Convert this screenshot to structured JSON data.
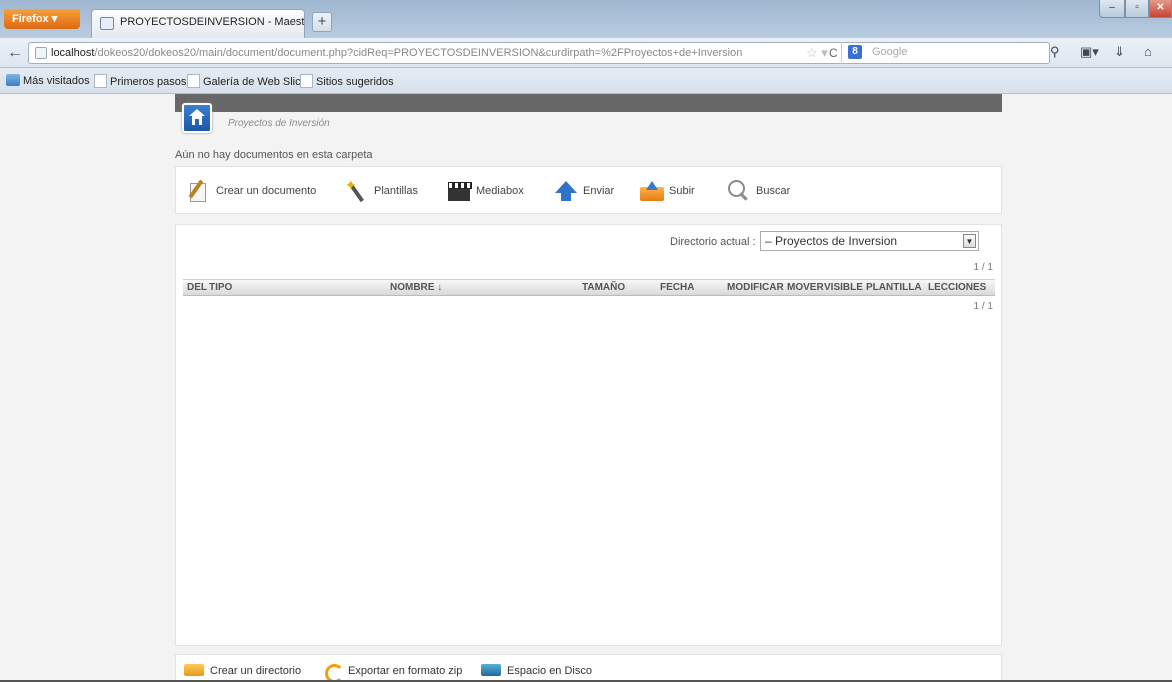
{
  "browser": {
    "app_button": "Firefox",
    "tab_title": "PROYECTOSDEINVERSION - Maestria en ...",
    "new_tab": "+",
    "url_host": "localhost",
    "url_rest": "/dokeos20/dokeos20/main/document/document.php?cidReq=PROYECTOSDEINVERSION&curdirpath=%2FProyectos+de+Inversion",
    "search_engine": "Google",
    "bookmarks": [
      "Más visitados",
      "Primeros pasos",
      "Galería de Web Slice",
      "Sitios sugeridos"
    ]
  },
  "page": {
    "breadcrumb": "Proyectos de Inversión",
    "empty_message": "Aún no hay documentos en esta carpeta",
    "toolbar": {
      "create_document": "Crear un documento",
      "templates": "Plantillas",
      "mediabox": "Mediabox",
      "send": "Enviar",
      "upload": "Subir",
      "search": "Buscar"
    },
    "current_dir_label": "Directorio actual :",
    "current_dir_value": "– Proyectos de Inversion",
    "pager_top": "1 / 1",
    "pager_bottom": "1 / 1",
    "columns": {
      "del": "DEL",
      "tipo": "TIPO",
      "nombre": "NOMBRE ↓",
      "tamano": "TAMAÑO",
      "fecha": "FECHA",
      "modificar": "MODIFICAR",
      "mover": "MOVER",
      "visible": "VISIBLE",
      "plantilla": "PLANTILLA",
      "lecciones": "LECCIONES"
    },
    "bottom_actions": {
      "create_dir": "Crear un directorio",
      "export_zip": "Exportar en formato zip",
      "disk_space": "Espacio en Disco"
    }
  },
  "colors": {
    "topbar": "#676767",
    "home_icon": "#1d57a8",
    "firefox_button": "#e8801f"
  }
}
